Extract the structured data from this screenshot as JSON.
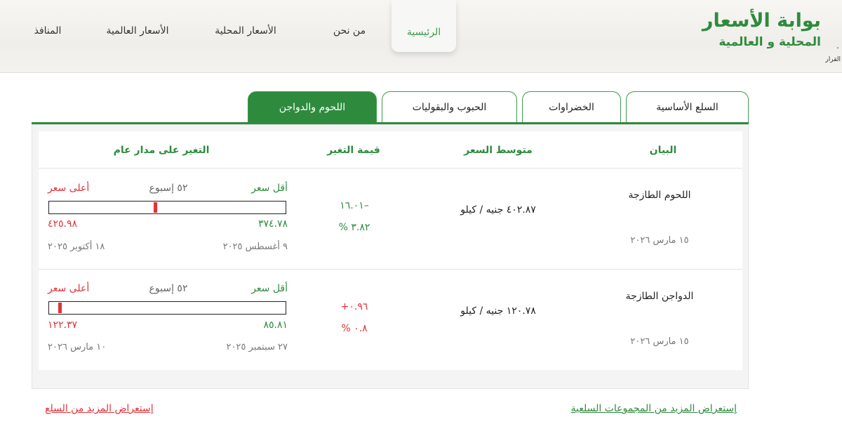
{
  "logo": {
    "title": "بوابة الأسعار",
    "subtitle": "المحلية و العالمية"
  },
  "edge": {
    "cut_text": "القرار",
    "cut_dot": "."
  },
  "nav": {
    "home": "الرئيسية",
    "about": "من نحن",
    "local": "الأسعار المحلية",
    "global": "الأسعار العالمية",
    "outlets": "المنافذ"
  },
  "tabs": {
    "basic": "السلع الأساسية",
    "vegetables": "الخضراوات",
    "grains": "الحبوب والبقوليات",
    "meat": "اللحوم والدواجن"
  },
  "table": {
    "headers": {
      "item": "البيان",
      "avg": "متوسط السعر",
      "change": "قيمة التغير",
      "year": "التغير على مدار عام"
    },
    "rows": [
      {
        "name": "اللحوم الطازجة",
        "date": "١٥ مارس ٢٠٢٦",
        "price": "٤٠٢.٨٧ جنيه / كيلو",
        "change_value": "١٦.٠١–",
        "change_pct": "% ٣.٨٢",
        "change_color": "#2e8b3e",
        "low_label": "أقل سعر",
        "week_label": "٥٢ إسبوع",
        "high_label": "أعلى سعر",
        "low_value": "٣٧٤.٧٨",
        "high_value": "٤٢٥.٩٨",
        "low_date": "٩ أغسطس ٢٠٢٥",
        "high_date": "١٨ أكتوبر ٢٠٢٥",
        "position": 0.55
      },
      {
        "name": "الدواجن الطازجة",
        "date": "١٥ مارس ٢٠٢٦",
        "price": "١٢٠.٧٨ جنيه / كيلو",
        "change_value": "+٠.٩٦",
        "change_pct": "% ٠.٨",
        "change_color": "#e0323a",
        "low_label": "أقل سعر",
        "week_label": "٥٢ إسبوع",
        "high_label": "أعلى سعر",
        "low_value": "٨٥.٨١",
        "high_value": "١٢٢.٣٧",
        "low_date": "٢٧ سبتمبر ٢٠٢٥",
        "high_date": "١٠ مارس ٢٠٢٦",
        "position": 0.96
      }
    ]
  },
  "links": {
    "groups": "إستعراض المزيد من المجموعات السلعية",
    "goods": "إستعراض المزيد من السلع"
  },
  "colors": {
    "brand_green": "#2e8b3e",
    "alert_red": "#e0323a"
  }
}
